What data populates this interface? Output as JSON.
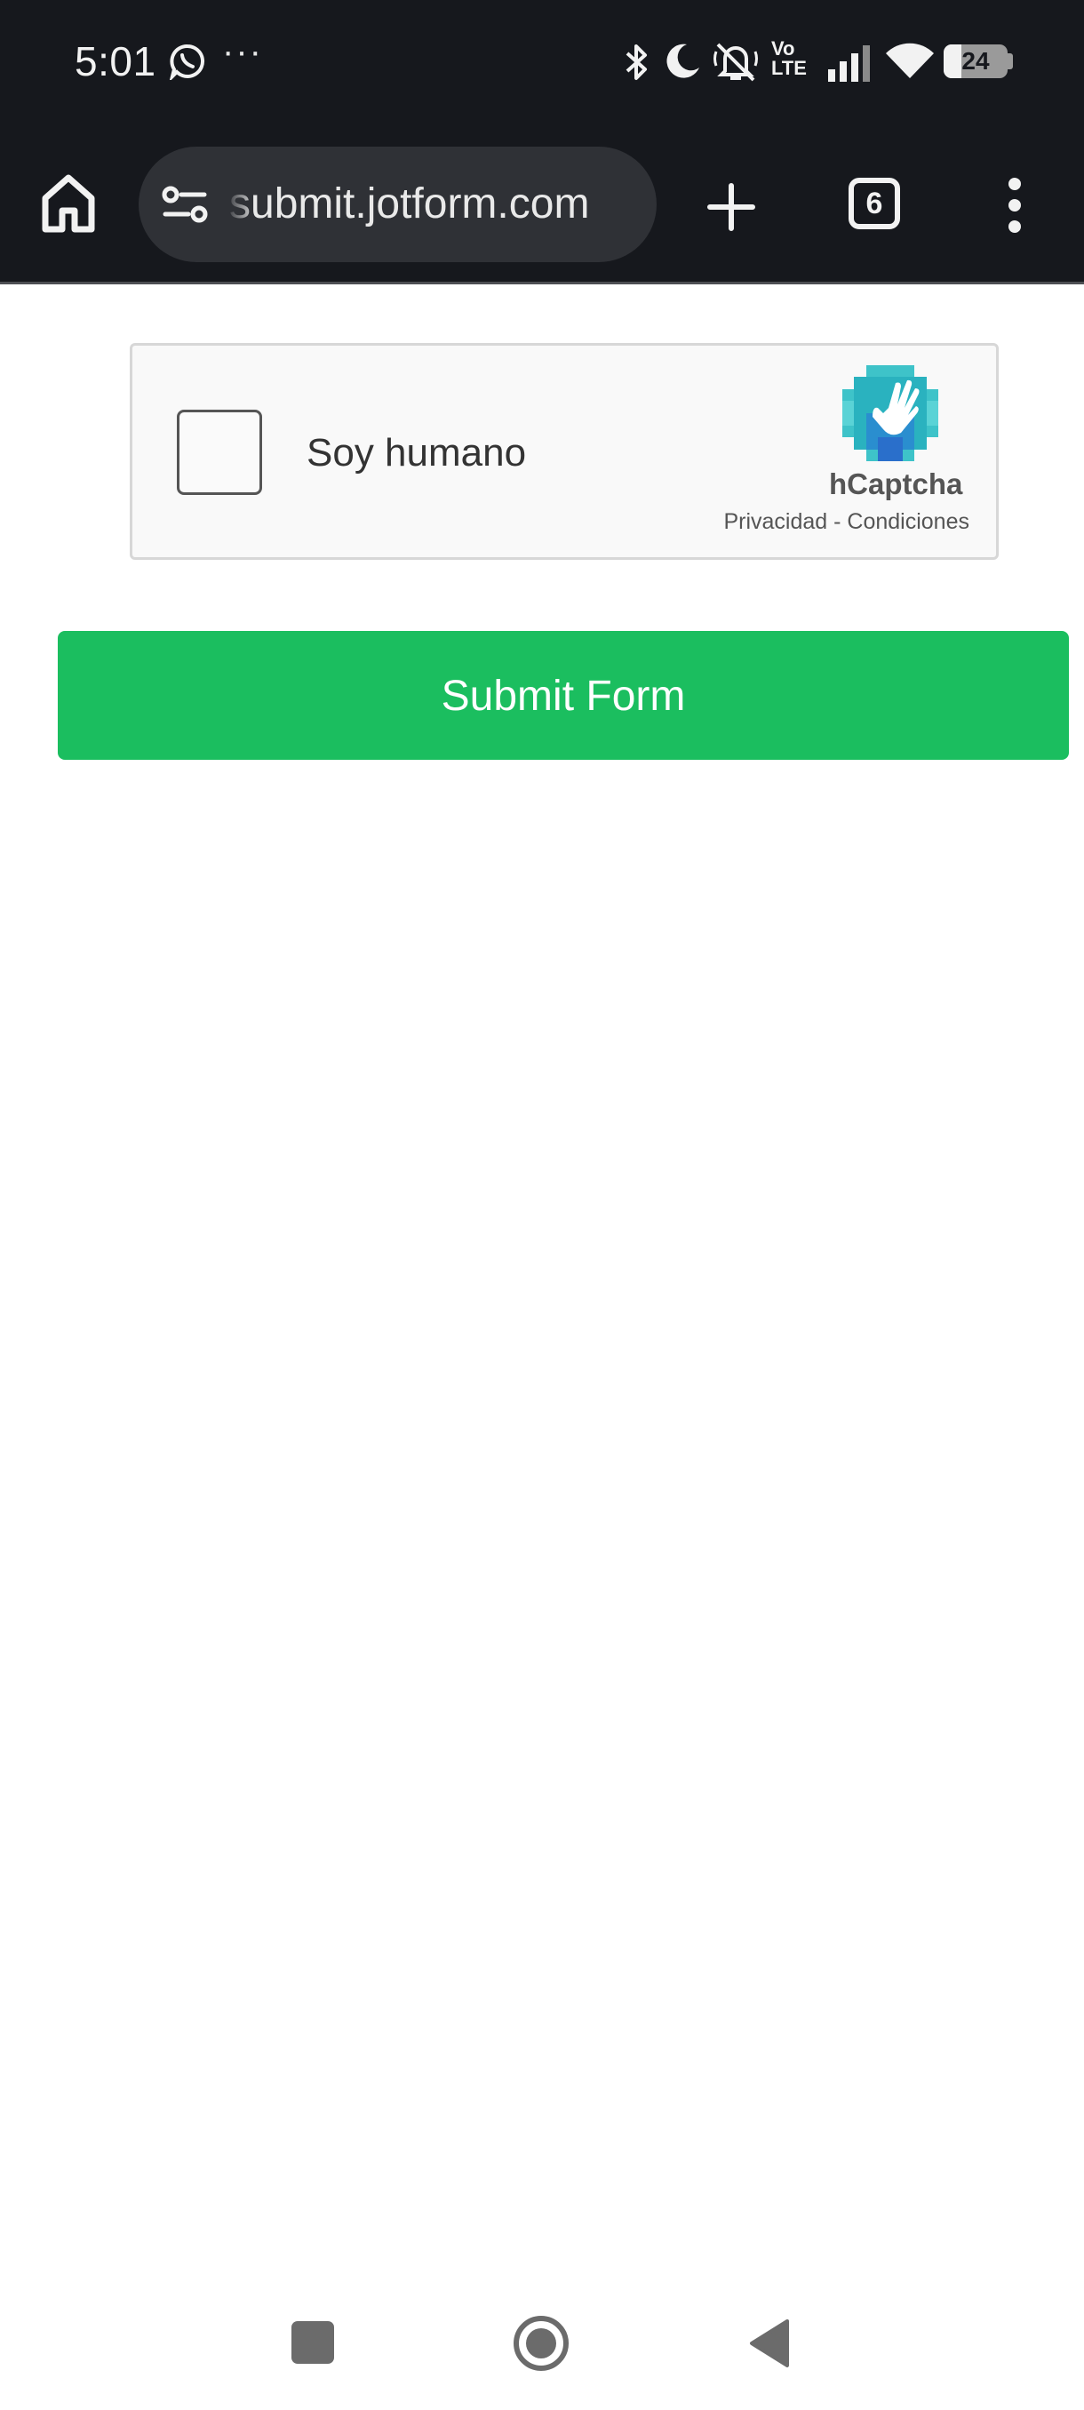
{
  "status_bar": {
    "time": "5:01",
    "more": "···",
    "battery": "24",
    "network": "Vo LTE",
    "icons": [
      "whatsapp-icon",
      "bluetooth-icon",
      "moon-icon",
      "bell-off-icon",
      "volte-icon",
      "signal-icon",
      "wifi-icon",
      "battery-icon"
    ]
  },
  "browser": {
    "url": "submit.jotform.com",
    "tab_count": "6",
    "icons": [
      "home-icon",
      "site-settings-icon",
      "new-tab-icon",
      "tab-switcher-icon",
      "menu-icon"
    ]
  },
  "captcha": {
    "label": "Soy humano",
    "brand": "hCaptcha",
    "links": "Privacidad - Condiciones",
    "checked": false
  },
  "form": {
    "submit_label": "Submit Form",
    "submit_color": "#1bbe5f"
  },
  "nav_bar": {
    "icons": [
      "recents-square-icon",
      "home-circle-icon",
      "back-triangle-icon"
    ]
  }
}
